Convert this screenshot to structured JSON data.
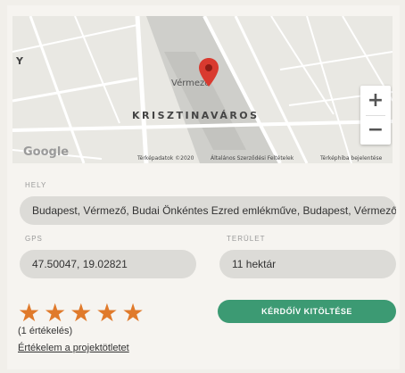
{
  "map": {
    "district_label": "KRISZTINAVÁROS",
    "place_label": "Vérmező",
    "edge_label": "Y",
    "google_logo": "Google",
    "attribution": {
      "map_data": "Térképadatok ©2020",
      "terms": "Általános Szerződési Feltételek",
      "report": "Térképhiba bejelentése"
    },
    "zoom_in": "+",
    "zoom_out": "−",
    "marker_color": "#d93a2f"
  },
  "fields": {
    "location": {
      "label": "HELY",
      "value": "Budapest, Vérmező, Budai Önkéntes Ezred emlékműve, Budapest, Vérmező park"
    },
    "gps": {
      "label": "GPS",
      "value": "47.50047, 19.02821"
    },
    "area": {
      "label": "TERÜLET",
      "value": "11 hektár"
    }
  },
  "rating": {
    "stars": 5,
    "star_glyph": "★",
    "star_color": "#e07a2b",
    "count_text": "(1 értékelés)",
    "rate_link": "Értékelem a projektötletet"
  },
  "actions": {
    "survey_button": "KÉRDŐÍV KITÖLTÉSE",
    "survey_button_color": "#3c9a73"
  }
}
